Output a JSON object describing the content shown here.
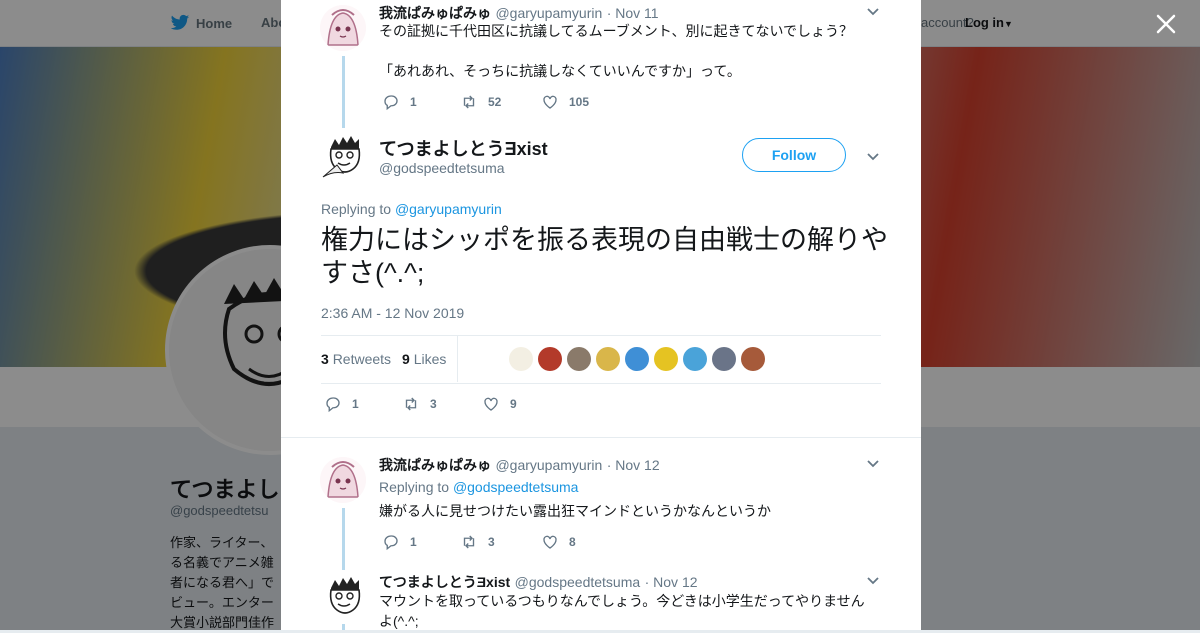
{
  "nav": {
    "home_label": "Home",
    "about_label": "Abo",
    "account_text": "account?",
    "login_label": "Log in"
  },
  "profile": {
    "name": "てつまよし",
    "handle": "@godspeedtetsu",
    "bio_lines": [
      "作家、ライター、",
      "る名義でアニメ雑",
      "者になる君へ」で",
      "ビュー。エンター",
      "大賞小説部門佳作"
    ]
  },
  "modal": {
    "reply1": {
      "name": "我流ぱみゅぱみゅ",
      "handle": "@garyupamyurin",
      "time": "· Nov 11",
      "lines": [
        "その証拠に千代田区に抗議してるムーブメント、別に起きてないでしょう？",
        "",
        "「あれあれ、そっちに抗議しなくていいんですか」って。"
      ],
      "replies": "1",
      "retweets": "52",
      "likes": "105"
    },
    "main": {
      "name": "てつまよしとうƎxist",
      "handle": "@godspeedtetsuma",
      "follow_label": "Follow",
      "replying_prefix": "Replying to ",
      "replying_handle": "@garyupamyurin",
      "text": "権力にはシッポを振る表現の自由戦士の解りやすさ(^.^;",
      "timestamp": "2:36 AM - 12 Nov 2019",
      "retweets_count": "3",
      "retweets_label": "Retweets",
      "likes_count": "9",
      "likes_label": "Likes",
      "liker_colors": [
        "#f3efe3",
        "#b33a2a",
        "#8a7a6a",
        "#d9b64a",
        "#3f8fd6",
        "#e5c322",
        "#4aa3d9",
        "#6a7488",
        "#a65a3a"
      ],
      "replies": "1",
      "retweets": "3",
      "likes": "9"
    },
    "reply2": {
      "name": "我流ぱみゅぱみゅ",
      "handle": "@garyupamyurin",
      "time": "· Nov 12",
      "replying_prefix": "Replying to ",
      "replying_handle": "@godspeedtetsuma",
      "text": "嫌がる人に見せつけたい露出狂マインドというかなんというか",
      "replies": "1",
      "retweets": "3",
      "likes": "8"
    },
    "reply3": {
      "name": "てつまよしとうƎxist",
      "handle": "@godspeedtetsuma",
      "time": "· Nov 12",
      "line1": "マウントを取っているつもりなんでしょう。今どきは小学生だってやりません",
      "line2": "よ(^.^;"
    }
  },
  "colors": {
    "accent": "#1da1f2",
    "link": "#1b95e0",
    "thread_line": "#b6d8ec"
  }
}
